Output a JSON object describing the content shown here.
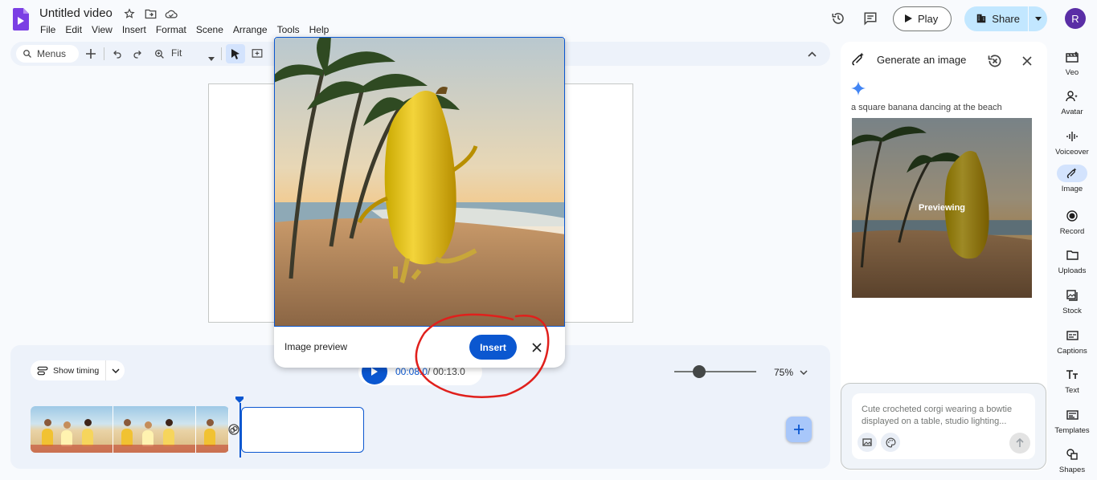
{
  "header": {
    "doc_title": "Untitled video",
    "menu": [
      "File",
      "Edit",
      "View",
      "Insert",
      "Format",
      "Scene",
      "Arrange",
      "Tools",
      "Help"
    ],
    "play_label": "Play",
    "share_label": "Share",
    "avatar_initial": "R"
  },
  "toolbar": {
    "menus_placeholder": "Menus",
    "zoom_mode": "Fit"
  },
  "popup": {
    "label": "Image preview",
    "insert_label": "Insert"
  },
  "timeline": {
    "show_timing_label": "Show timing",
    "current_time": "00:08.0",
    "total_time": "/ 00:13.0",
    "zoom_value": "75%",
    "zoom_level": 0.3
  },
  "gen_panel": {
    "title": "Generate an image",
    "prompt": "a square banana dancing at the beach",
    "previewing_label": "Previewing",
    "input_placeholder": "Cute crocheted corgi wearing a bowtie displayed on a table, studio lighting..."
  },
  "rail": [
    {
      "label": "Veo",
      "icon": "veo-icon"
    },
    {
      "label": "Avatar",
      "icon": "avatar-icon"
    },
    {
      "label": "Voiceover",
      "icon": "voiceover-icon"
    },
    {
      "label": "Image",
      "icon": "image-icon",
      "active": true
    },
    {
      "label": "Record",
      "icon": "record-icon"
    },
    {
      "label": "Uploads",
      "icon": "folder-icon"
    },
    {
      "label": "Stock",
      "icon": "stock-icon"
    },
    {
      "label": "Captions",
      "icon": "captions-icon"
    },
    {
      "label": "Text",
      "icon": "text-icon"
    },
    {
      "label": "Templates",
      "icon": "templates-icon"
    },
    {
      "label": "Shapes",
      "icon": "shapes-icon"
    }
  ],
  "colors": {
    "accent": "#0b57d0",
    "share_bg": "#c2e7ff",
    "annotation": "#e0201c"
  }
}
